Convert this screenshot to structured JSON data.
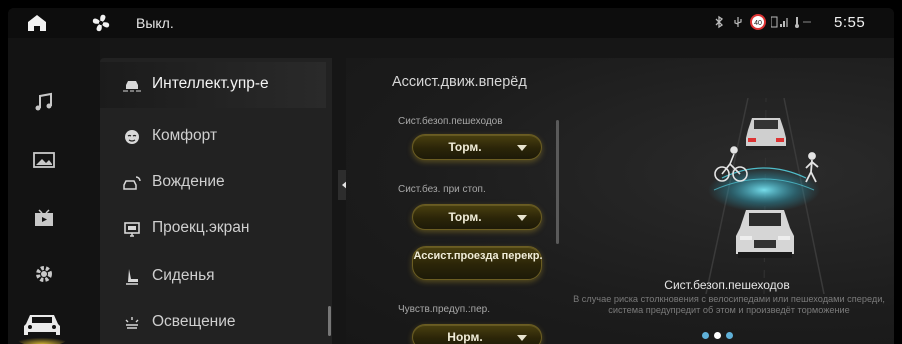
{
  "topbar": {
    "fan_status": "Выкл.",
    "time": "5:55",
    "icons": [
      "home-icon",
      "fan-icon",
      "bluetooth-icon",
      "usb-icon",
      "speed-limit-icon",
      "signal-icon",
      "temperature-icon"
    ],
    "speed_limit": "40"
  },
  "left_rail": [
    "music-icon",
    "gallery-icon",
    "video-icon",
    "settings-icon",
    "car-icon"
  ],
  "menu": {
    "items": [
      {
        "label": "Интеллект.упр-е",
        "icon": "driver-assist-icon",
        "active": true
      },
      {
        "label": "Комфорт",
        "icon": "comfort-icon",
        "active": false
      },
      {
        "label": "Вождение",
        "icon": "driving-icon",
        "active": false
      },
      {
        "label": "Проекц.экран",
        "icon": "projection-screen-icon",
        "active": false
      },
      {
        "label": "Сиденья",
        "icon": "seat-icon",
        "active": false
      },
      {
        "label": "Освещение",
        "icon": "lighting-icon",
        "active": false
      }
    ]
  },
  "content": {
    "title": "Ассист.движ.вперёд",
    "options": [
      {
        "label": "Сист.безоп.пешеходов",
        "value": "Торм."
      },
      {
        "label": "Сист.без. при стоп.",
        "value": "Торм."
      },
      {
        "label": "",
        "value": "Ассист.проезда перекр."
      },
      {
        "label": "Чувств.предуп.:пер.",
        "value": "Норм."
      }
    ]
  },
  "illustration": {
    "title": "Сист.безоп.пешеходов",
    "description": "В случае риска столкновения с велосипедами или пешеходами спереди, система предупредит об этом и произведёт торможение",
    "pages": 3,
    "current_page": 1
  },
  "colors": {
    "accent_gold": "#c9a72a",
    "accent_cyan": "#4fd4e8"
  }
}
